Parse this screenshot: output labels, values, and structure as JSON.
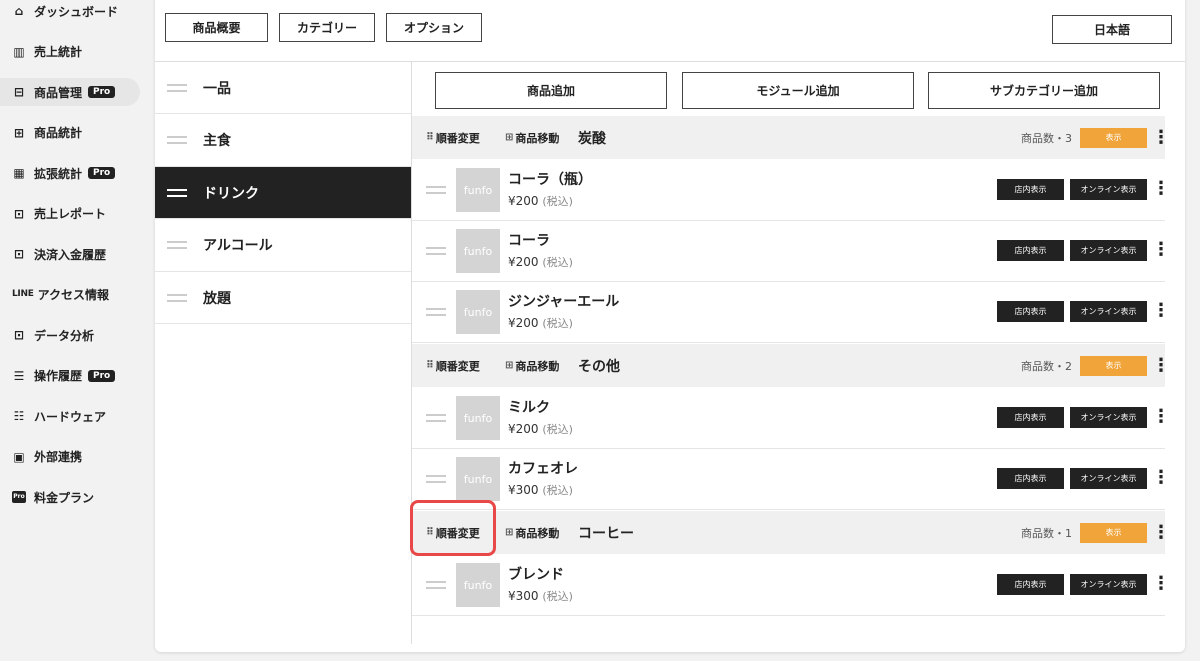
{
  "sidebar": {
    "items": [
      {
        "label": "ダッシュボード",
        "icon": "home-icon",
        "glyph": "⌂",
        "pro": false,
        "active": false
      },
      {
        "label": "売上統計",
        "icon": "bar-chart-icon",
        "glyph": "▥",
        "pro": false,
        "active": false
      },
      {
        "label": "商品管理",
        "icon": "product-manage-icon",
        "glyph": "⊟",
        "pro": true,
        "active": true
      },
      {
        "label": "商品統計",
        "icon": "grid-icon",
        "glyph": "⊞",
        "pro": false,
        "active": false
      },
      {
        "label": "拡張統計",
        "icon": "extended-chart-icon",
        "glyph": "▦",
        "pro": true,
        "active": false
      },
      {
        "label": "売上レポート",
        "icon": "report-icon",
        "glyph": "⊡",
        "pro": false,
        "active": false
      },
      {
        "label": "決済入金履歴",
        "icon": "payment-icon",
        "glyph": "⊡",
        "pro": false,
        "active": false
      },
      {
        "label": "アクセス情報",
        "icon": "line-logo-icon",
        "glyph": "LINE",
        "pro": false,
        "active": false
      },
      {
        "label": "データ分析",
        "icon": "analysis-icon",
        "glyph": "⊡",
        "pro": false,
        "active": false
      },
      {
        "label": "操作履歴",
        "icon": "history-icon",
        "glyph": "☰",
        "pro": true,
        "active": false
      },
      {
        "label": "ハードウェア",
        "icon": "hardware-icon",
        "glyph": "☷",
        "pro": false,
        "active": false
      },
      {
        "label": "外部連携",
        "icon": "external-link-icon",
        "glyph": "▣",
        "pro": false,
        "active": false
      },
      {
        "label": "料金プラン",
        "icon": "pro-plan-icon",
        "glyph": "Pro",
        "pro": false,
        "active": false
      }
    ],
    "pro_label": "Pro"
  },
  "tabs": [
    {
      "label": "商品概要",
      "active": true
    },
    {
      "label": "カテゴリー",
      "active": false
    },
    {
      "label": "オプション",
      "active": false
    }
  ],
  "language": "日本語",
  "categories": [
    {
      "label": "一品",
      "active": false
    },
    {
      "label": "主食",
      "active": false
    },
    {
      "label": "ドリンク",
      "active": true
    },
    {
      "label": "アルコール",
      "active": false
    },
    {
      "label": "放題",
      "active": false
    }
  ],
  "actions": [
    "商品追加",
    "モジュール追加",
    "サブカテゴリー追加"
  ],
  "labels": {
    "reorder": "順番変更",
    "move": "商品移動",
    "show": "表示",
    "store_display": "店内表示",
    "online_display": "オンライン表示",
    "tax": "(税込)",
    "thumb_text": "funfo",
    "reorder_glyph": "⠿",
    "move_glyph": "⊞",
    "kebab": "⋮"
  },
  "groups": [
    {
      "title": "炭酸",
      "count_text": "商品数・3",
      "products": [
        {
          "name": "コーラ（瓶）",
          "price": "¥200"
        },
        {
          "name": "コーラ",
          "price": "¥200"
        },
        {
          "name": "ジンジャーエール",
          "price": "¥200"
        }
      ]
    },
    {
      "title": "その他",
      "count_text": "商品数・2",
      "products": [
        {
          "name": "ミルク",
          "price": "¥200"
        },
        {
          "name": "カフェオレ",
          "price": "¥300"
        }
      ]
    },
    {
      "title": "コーヒー",
      "count_text": "商品数・1",
      "products": [
        {
          "name": "ブレンド",
          "price": "¥300"
        }
      ]
    }
  ]
}
